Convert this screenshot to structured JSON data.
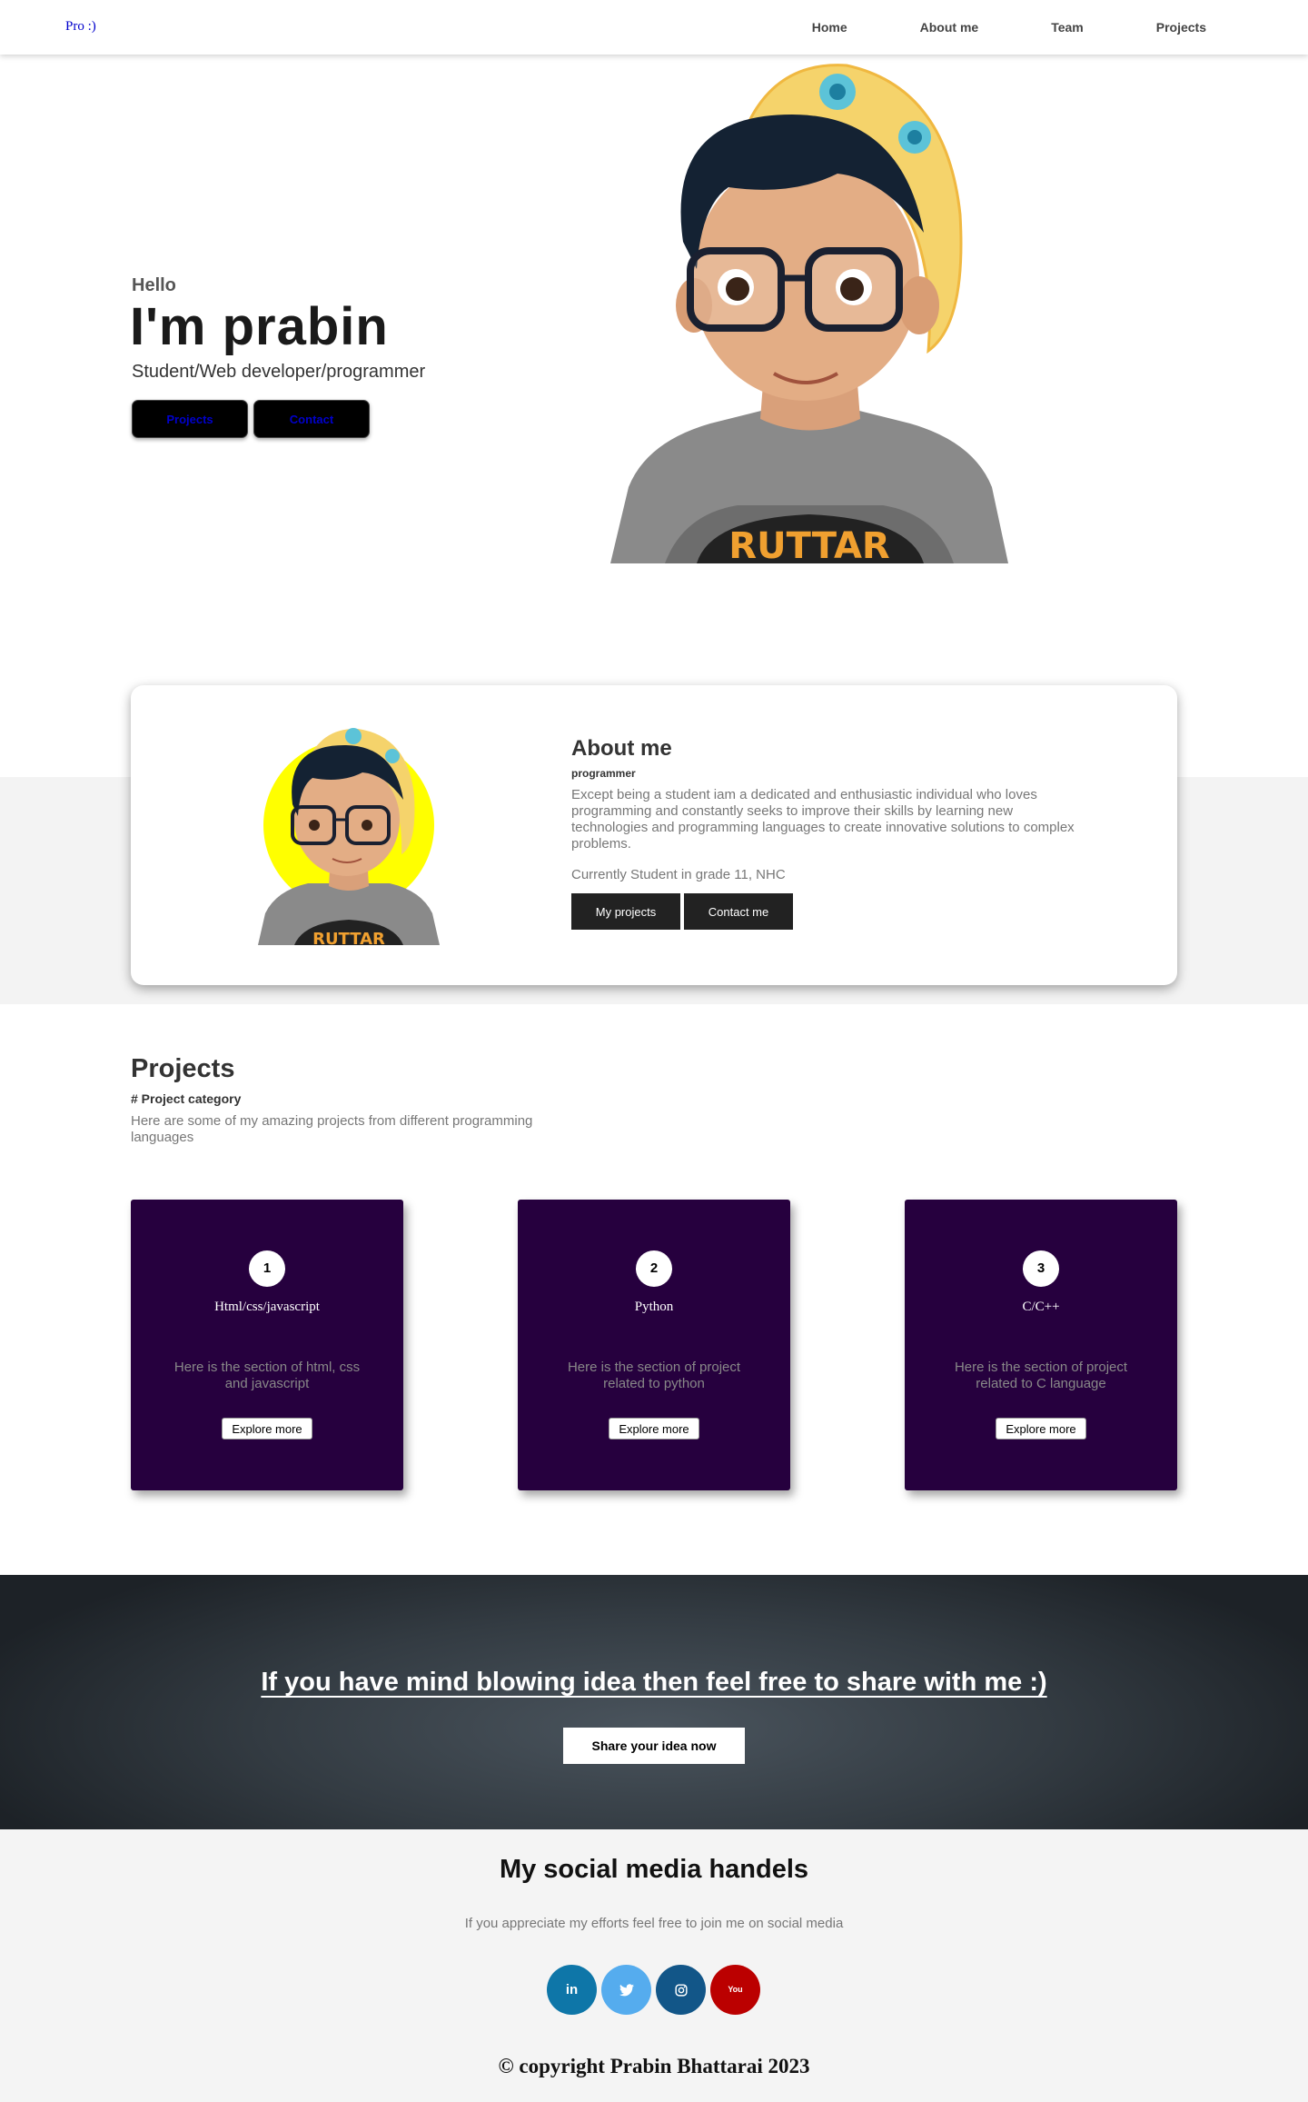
{
  "nav": {
    "logo": "Pro :)",
    "links": [
      "Home",
      "About me",
      "Team",
      "Projects"
    ]
  },
  "hero": {
    "greeting": "Hello",
    "name": "I'm prabin",
    "role": "Student/Web developer/programmer",
    "buttons": [
      "Projects",
      "Contact"
    ],
    "shirt_text": "RUTTAR"
  },
  "about": {
    "title": "About me",
    "subtitle": "programmer",
    "description": "Except being a student iam a dedicated and enthusiastic individual who loves programming and constantly seeks to improve their skills by learning new technologies and programming languages to create innovative solutions to complex problems.",
    "current": "Currently Student in grade 11, NHC",
    "buttons": [
      "My projects",
      "Contact me"
    ]
  },
  "projects": {
    "title": "Projects",
    "category": "# Project category",
    "description": "Here are some of my amazing projects from different programming languages",
    "cards": [
      {
        "number": "1",
        "title": "Html/css/javascript",
        "description": "Here is the section of html, css and javascript",
        "button": "Explore more"
      },
      {
        "number": "2",
        "title": "Python",
        "description": "Here is the section of project related to python",
        "button": "Explore more"
      },
      {
        "number": "3",
        "title": "C/C++",
        "description": "Here is the section of project related to C language",
        "button": "Explore more"
      }
    ]
  },
  "idea": {
    "heading": "If you have mind blowing idea then feel free to share with me :)",
    "button": "Share your idea now"
  },
  "social": {
    "title": "My social media handels",
    "text": "If you appreciate my efforts feel free to join me on social media",
    "icons": [
      {
        "name": "linkedin-icon",
        "label": "in",
        "color": "#0e76a8"
      },
      {
        "name": "twitter-icon",
        "label": "",
        "color": "#55acee"
      },
      {
        "name": "instagram-icon",
        "label": "",
        "color": "#125688"
      },
      {
        "name": "youtube-icon",
        "label": "You",
        "color": "#bb0000"
      }
    ],
    "copyright": "© copyright Prabin Bhattarai 2023"
  }
}
